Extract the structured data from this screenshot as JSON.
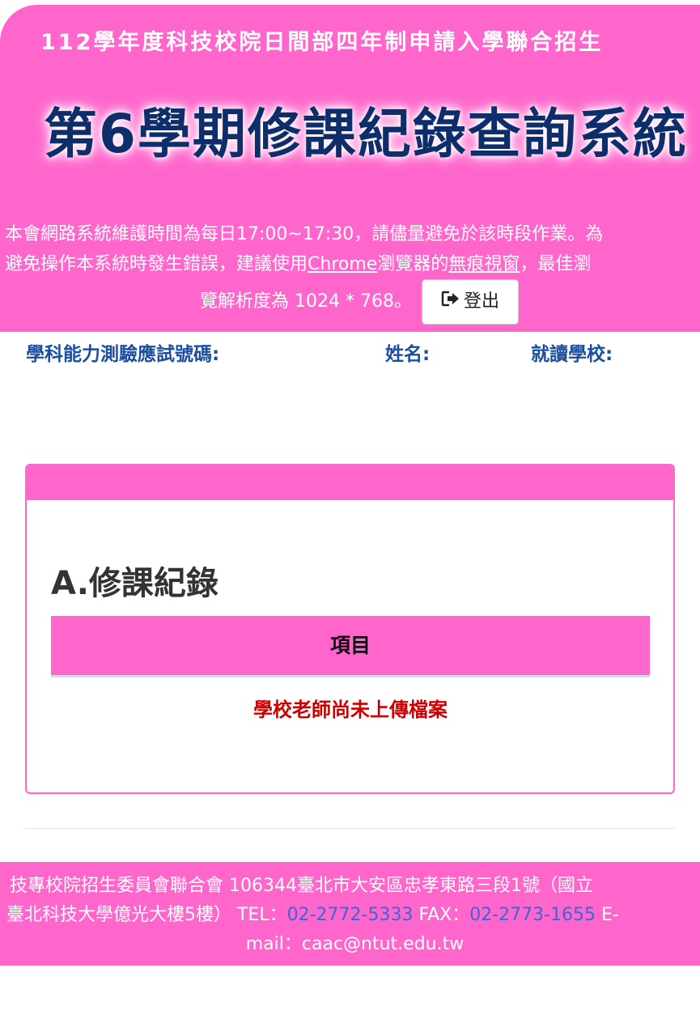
{
  "header": {
    "subtitle": "112學年度科技校院日間部四年制申請入學聯合招生",
    "title": "第6學期修課紀錄查詢系統",
    "notice": {
      "line1": "本會網路系統維護時間為每日17:00~17:30，請儘量避免於該時段作業。為",
      "line2_a": "避免操作本系統時發生錯誤，建議使用",
      "line2_link1": "Chrome",
      "line2_b": "瀏覽器的",
      "line2_link2": "無痕視窗",
      "line2_c": "，最佳瀏",
      "line3": "覽解析度為 1024 * 768。"
    },
    "logout_label": "登出"
  },
  "info": {
    "exam_no_label": "學科能力測驗應試號碼:",
    "name_label": "姓名:",
    "school_label": "就讀學校:"
  },
  "card": {
    "section_title": "A.修課紀錄",
    "table_header": "項目",
    "empty_message": "學校老師尚未上傳檔案"
  },
  "footer": {
    "line1": "技專校院招生委員會聯合會 106344臺北市大安區忠孝東路三段1號（國立",
    "line2_a": "臺北科技大學億光大樓5樓） TEL：",
    "tel": "02-2772-5333",
    "line2_b": " FAX：",
    "fax": "02-2773-1655",
    "line2_c": " E-",
    "line3": "mail：caac@ntut.edu.tw"
  },
  "colors": {
    "brand_pink": "#ff66cc",
    "title_navy": "#0d2d6b",
    "label_blue": "#1a4fa0",
    "error_red": "#cc0000",
    "phone_blue": "#3a66d6"
  }
}
